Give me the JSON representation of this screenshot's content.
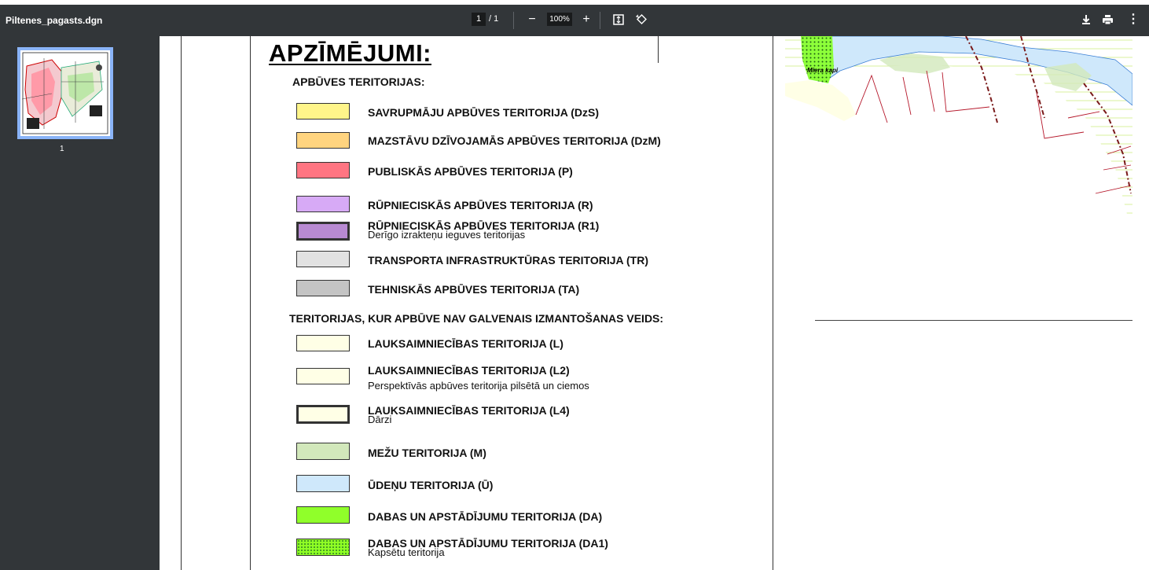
{
  "app": {
    "file_title": "Piltenes_pagasts.dgn",
    "page_current": "1",
    "page_total": "/ 1",
    "zoom": "100%",
    "thumb_label": "1",
    "icons": [
      "minus-icon",
      "plus-icon",
      "fit-page-icon",
      "rotate-icon",
      "download-icon",
      "print-icon",
      "more-icon"
    ]
  },
  "legend": {
    "title": "APZĪMĒJUMI:",
    "section1": "APBŪVES TERITORIJAS:",
    "section2": "TERITORIJAS, KUR APBŪVE NAV GALVENAIS IZMANTOŠANAS VEIDS:",
    "items": [
      {
        "label": "SAVRUPMĀJU APBŪVES TERITORIJA (DzS)",
        "sub": "",
        "color": "#fff58a"
      },
      {
        "label": "MAZSTĀVU DZĪVOJAMĀS APBŪVES TERITORIJA (DzM)",
        "sub": "",
        "color": "#ffd47f"
      },
      {
        "label": "PUBLISKĀS APBŪVES TERITORIJA (P)",
        "sub": "",
        "color": "#ff7582"
      },
      {
        "label": "RŪPNIECISKĀS APBŪVES TERITORIJA (R)",
        "sub": "",
        "color": "#d7aaf6"
      },
      {
        "label": "RŪPNIECISKĀS APBŪVES TERITORIJA (R1)",
        "sub": "Derīgo izrakteņu ieguves teritorijas",
        "color": "#b88ad2"
      },
      {
        "label": "TRANSPORTA INFRASTRUKTŪRAS TERITORIJA (TR)",
        "sub": "",
        "color": "#e2e2e2"
      },
      {
        "label": "TEHNISKĀS APBŪVES TERITORIJA (TA)",
        "sub": "",
        "color": "#c4c4c4"
      },
      {
        "label": "LAUKSAIMNIECĪBAS TERITORIJA (L)",
        "sub": "",
        "color": "#ffffe6"
      },
      {
        "label": "LAUKSAIMNIECĪBAS TERITORIJA (L2)",
        "sub": "Perspektīvās apbūves teritorija pilsētā un ciemos",
        "color": "#ffffe6"
      },
      {
        "label": "LAUKSAIMNIECĪBAS TERITORIJA (L4)",
        "sub": "Dārzi",
        "color": "#ffffe6"
      },
      {
        "label": "MEŽU TERITORIJA (M)",
        "sub": "",
        "color": "#d2e8bb"
      },
      {
        "label": "ŪDEŅU TERITORIJA (Ū)",
        "sub": "",
        "color": "#cfe8fb"
      },
      {
        "label": "DABAS UN APSTĀDĪJUMU TERITORIJA (DA)",
        "sub": "",
        "color": "#90ff2a"
      },
      {
        "label": "DABAS UN APSTĀDĪJUMU TERITORIJA (DA1)",
        "sub": "Kapsētu teritorija",
        "color": "#90ff2a"
      }
    ]
  },
  "map": {
    "place_label": "Miera kapi"
  }
}
